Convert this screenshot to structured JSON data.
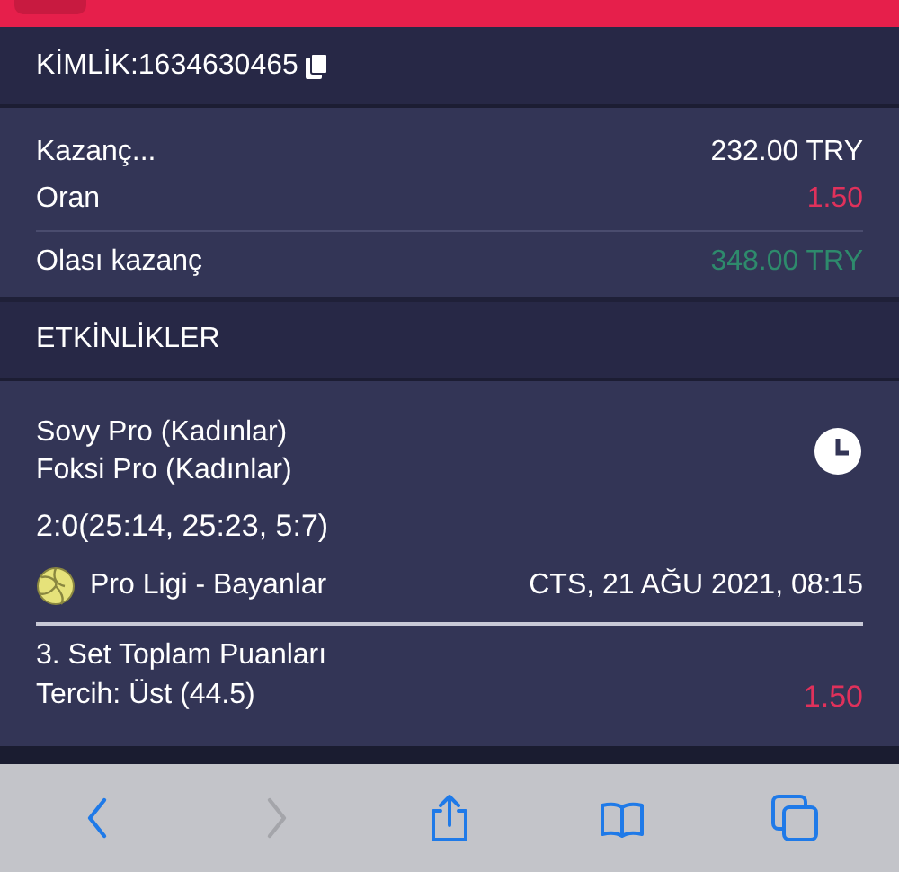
{
  "header": {
    "id_text": "KİMLİK:1634630465"
  },
  "summary": [
    {
      "label": "Kazanç...",
      "value": "232.00 TRY",
      "kind": "plain"
    },
    {
      "label": "Oran",
      "value": "1.50",
      "kind": "odds"
    },
    {
      "label": "Olası kazanç",
      "value": "348.00 TRY",
      "kind": "win"
    }
  ],
  "events_title": "ETKİNLİKLER",
  "event": {
    "teams": [
      "Sovy Pro (Kadınlar)",
      "Foksi Pro (Kadınlar)"
    ],
    "score": "2:0(25:14, 25:23, 5:7)",
    "league": "Pro Ligi - Bayanlar",
    "date": "CTS, 21 AĞU 2021, 08:15",
    "market": "3. Set Toplam Puanları",
    "pick": "Tercih: Üst (44.5)",
    "odds": "1.50"
  },
  "toolbar": [
    {
      "kind": "back",
      "disabled": false
    },
    {
      "kind": "forward",
      "disabled": true
    },
    {
      "kind": "share",
      "disabled": false
    },
    {
      "kind": "bookmarks",
      "disabled": false
    },
    {
      "kind": "tabs",
      "disabled": false
    }
  ]
}
